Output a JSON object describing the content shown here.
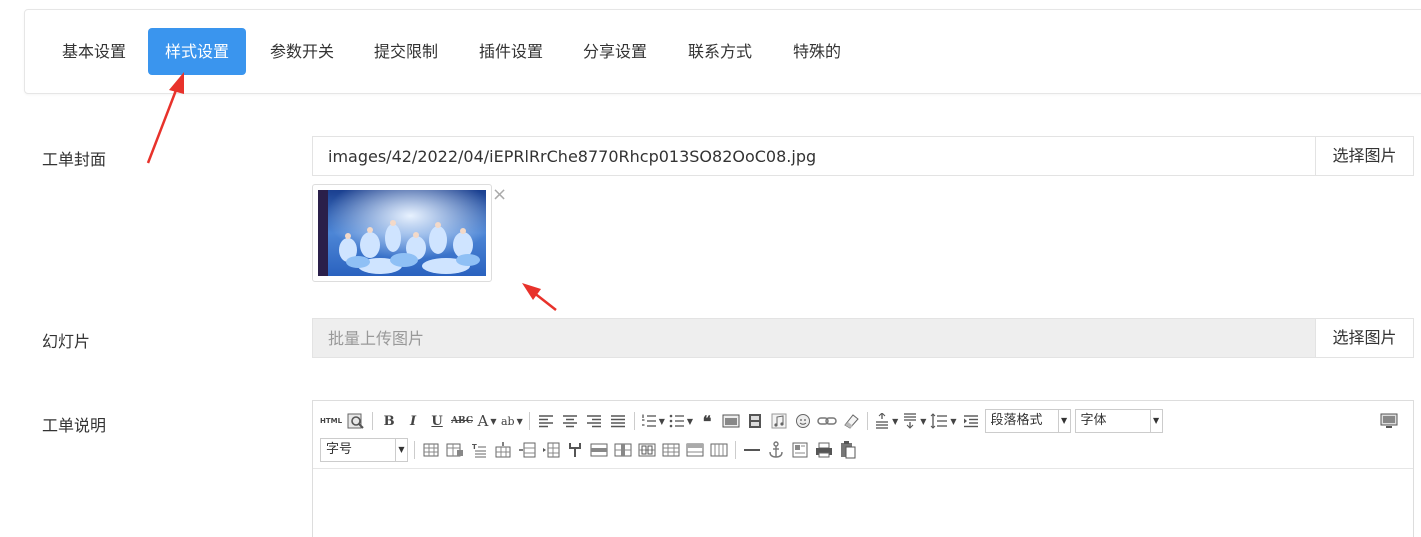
{
  "tabs": [
    {
      "label": "基本设置",
      "active": false
    },
    {
      "label": "样式设置",
      "active": true
    },
    {
      "label": "参数开关",
      "active": false
    },
    {
      "label": "提交限制",
      "active": false
    },
    {
      "label": "插件设置",
      "active": false
    },
    {
      "label": "分享设置",
      "active": false
    },
    {
      "label": "联系方式",
      "active": false
    },
    {
      "label": "特殊的",
      "active": false
    }
  ],
  "cover": {
    "label": "工单封面",
    "value": "images/42/2022/04/iEPRlRrChe8770Rhcp013SO82OoC08.jpg",
    "button": "选择图片",
    "remove_icon": "×"
  },
  "slides": {
    "label": "幻灯片",
    "placeholder": "批量上传图片",
    "button": "选择图片"
  },
  "description": {
    "label": "工单说明",
    "toolbar": {
      "html_label": "HTML",
      "paragraph_select": "段落格式",
      "font_select": "字体",
      "size_select": "字号",
      "icons_row1": [
        "html-source-icon",
        "preview-icon",
        "bold-icon",
        "italic-icon",
        "underline-icon",
        "strikethrough-icon",
        "font-color-icon",
        "highlight-icon",
        "align-left-icon",
        "align-center-icon",
        "align-right-icon",
        "align-justify-icon",
        "ordered-list-icon",
        "unordered-list-icon",
        "quote-icon",
        "image-icon",
        "video-icon",
        "music-icon",
        "emoji-icon",
        "link-icon",
        "eraser-icon",
        "paragraph-spacing-top-icon",
        "paragraph-spacing-bottom-icon",
        "line-height-icon",
        "indent-icon",
        "fullscreen-icon"
      ],
      "icons_row2": [
        "insert-table-icon",
        "table-props-icon",
        "caption-icon",
        "insert-row-icon",
        "insert-col-icon",
        "merge-icon",
        "split-icon",
        "delete-row-icon",
        "delete-col-icon",
        "table-cells-icon",
        "horizontal-rule-icon",
        "anchor-icon",
        "template-icon",
        "print-icon",
        "paste-icon"
      ]
    }
  },
  "colors": {
    "accent": "#3a95ee",
    "arrow": "#e8322b"
  }
}
